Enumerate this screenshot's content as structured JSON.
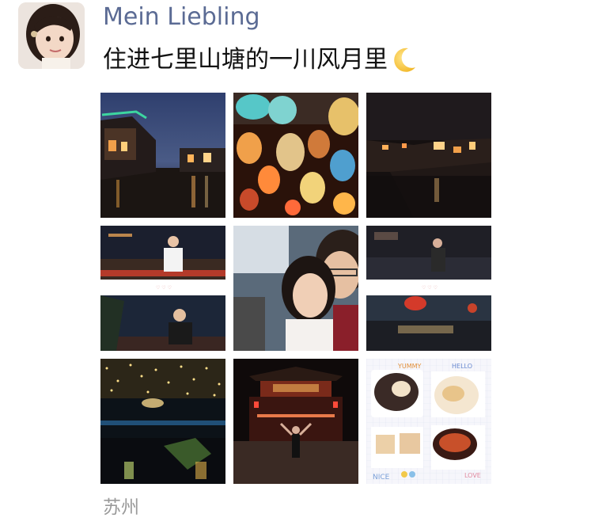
{
  "post": {
    "username": "Mein Liebling",
    "text": "住进七里山塘的一川风月里",
    "emoji_icon": "crescent-moon-icon",
    "location": "苏州"
  },
  "photos": [
    {
      "name": "photo-canal-dusk",
      "alt": "canal at dusk"
    },
    {
      "name": "photo-lanterns",
      "alt": "lanterns"
    },
    {
      "name": "photo-canal-night",
      "alt": "canal at night"
    },
    {
      "name": "photo-collage-canal-portraits",
      "alt": "collage canal portraits"
    },
    {
      "name": "photo-couple-selfie",
      "alt": "couple selfie"
    },
    {
      "name": "photo-collage-canal-lanterns",
      "alt": "collage canal lanterns"
    },
    {
      "name": "photo-lights-bar",
      "alt": "lights bar"
    },
    {
      "name": "photo-pavilion",
      "alt": "pavilion"
    },
    {
      "name": "photo-food-collage",
      "alt": "food collage"
    }
  ],
  "collage_texts": {
    "food_top": "YUMMY",
    "food_hello": "HELLO",
    "food_nice": "NICE",
    "food_love": "LOVE"
  }
}
